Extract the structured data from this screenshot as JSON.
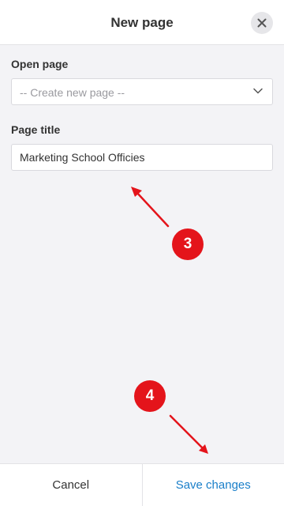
{
  "header": {
    "title": "New page",
    "close_icon": "close-icon"
  },
  "form": {
    "open_page": {
      "label": "Open page",
      "selected": "-- Create new page --"
    },
    "page_title": {
      "label": "Page title",
      "value": "Marketing School Officies"
    }
  },
  "annotations": {
    "step_3": "3",
    "step_4": "4",
    "color": "#e4141b"
  },
  "footer": {
    "cancel_label": "Cancel",
    "save_label": "Save changes"
  },
  "colors": {
    "accent": "#1a7fc9",
    "background": "#f3f3f6"
  }
}
